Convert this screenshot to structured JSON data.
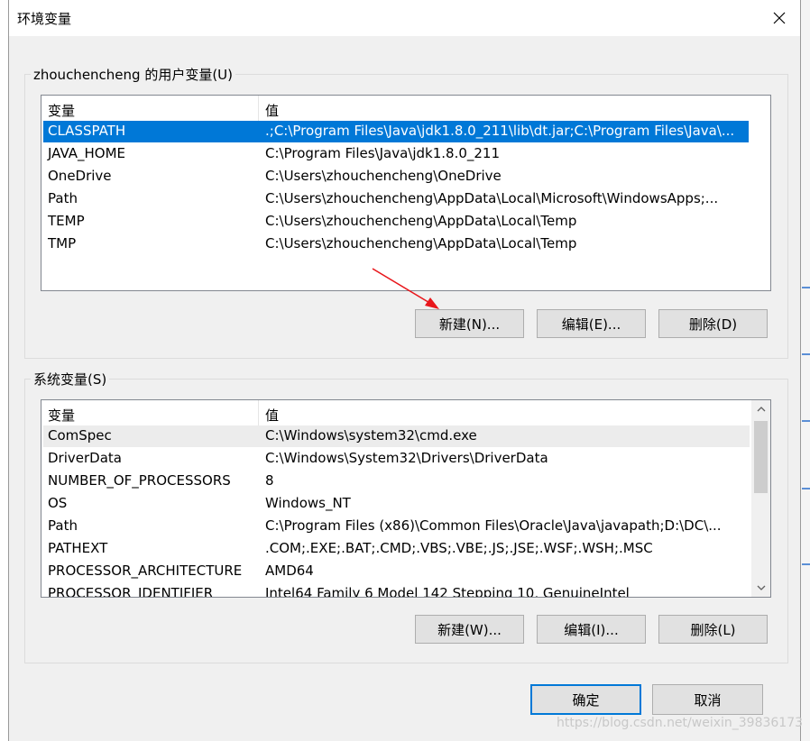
{
  "window": {
    "title": "环境变量",
    "close_glyph": "✕"
  },
  "user_vars": {
    "label": "zhouchencheng 的用户变量(U)",
    "headers": {
      "name": "变量",
      "value": "值"
    },
    "rows": [
      {
        "name": "CLASSPATH",
        "value": ".;C:\\Program Files\\Java\\jdk1.8.0_211\\lib\\dt.jar;C:\\Program Files\\Java\\..."
      },
      {
        "name": "JAVA_HOME",
        "value": "C:\\Program Files\\Java\\jdk1.8.0_211"
      },
      {
        "name": "OneDrive",
        "value": "C:\\Users\\zhouchencheng\\OneDrive"
      },
      {
        "name": "Path",
        "value": "C:\\Users\\zhouchencheng\\AppData\\Local\\Microsoft\\WindowsApps;..."
      },
      {
        "name": "TEMP",
        "value": "C:\\Users\\zhouchencheng\\AppData\\Local\\Temp"
      },
      {
        "name": "TMP",
        "value": "C:\\Users\\zhouchencheng\\AppData\\Local\\Temp"
      }
    ],
    "selected_index": 0,
    "buttons": {
      "new": "新建(N)...",
      "edit": "编辑(E)...",
      "delete": "删除(D)"
    }
  },
  "system_vars": {
    "label": "系统变量(S)",
    "headers": {
      "name": "变量",
      "value": "值"
    },
    "rows": [
      {
        "name": "ComSpec",
        "value": "C:\\Windows\\system32\\cmd.exe"
      },
      {
        "name": "DriverData",
        "value": "C:\\Windows\\System32\\Drivers\\DriverData"
      },
      {
        "name": "NUMBER_OF_PROCESSORS",
        "value": "8"
      },
      {
        "name": "OS",
        "value": "Windows_NT"
      },
      {
        "name": "Path",
        "value": "C:\\Program Files (x86)\\Common Files\\Oracle\\Java\\javapath;D:\\DC\\..."
      },
      {
        "name": "PATHEXT",
        "value": ".COM;.EXE;.BAT;.CMD;.VBS;.VBE;.JS;.JSE;.WSF;.WSH;.MSC"
      },
      {
        "name": "PROCESSOR_ARCHITECTURE",
        "value": "AMD64"
      },
      {
        "name": "PROCESSOR_IDENTIFIER",
        "value": "Intel64 Family 6 Model 142 Stepping 10, GenuineIntel"
      }
    ],
    "highlighted_index": 0,
    "buttons": {
      "new": "新建(W)...",
      "edit": "编辑(I)...",
      "delete": "删除(L)"
    }
  },
  "footer": {
    "ok": "确定",
    "cancel": "取消"
  },
  "watermark": "https://blog.csdn.net/weixin_39836173",
  "colors": {
    "selection": "#0078d7",
    "annotation_arrow": "#e8161b"
  }
}
